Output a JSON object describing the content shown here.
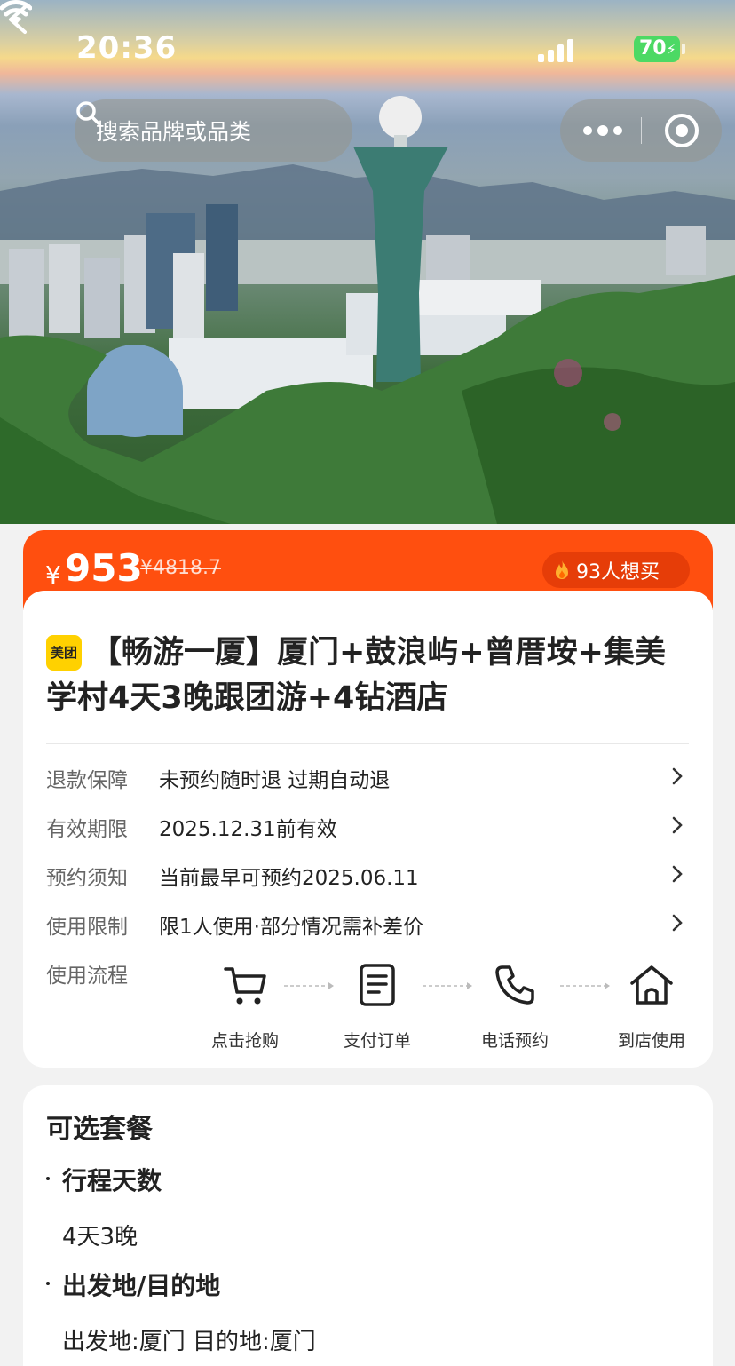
{
  "status_bar": {
    "time": "20:36",
    "battery": "70"
  },
  "nav": {
    "search_placeholder": "搜索品牌或品类"
  },
  "price": {
    "currency": "¥",
    "current": "953",
    "original": "¥4818.7",
    "want_count": "93人想买"
  },
  "product": {
    "brand": "美团",
    "title": "【畅游一厦】厦门+鼓浪屿+曾厝垵+集美学村4天3晚跟团游+4钻酒店"
  },
  "info_rows": [
    {
      "label": "退款保障",
      "value": "未预约随时退 过期自动退"
    },
    {
      "label": "有效期限",
      "value": "2025.12.31前有效"
    },
    {
      "label": "预约须知",
      "value": "当前最早可预约2025.06.11"
    },
    {
      "label": "使用限制",
      "value": "限1人使用·部分情况需补差价"
    }
  ],
  "usage_flow": {
    "label": "使用流程",
    "steps": [
      {
        "label": "点击抢购",
        "icon": "cart-icon"
      },
      {
        "label": "支付订单",
        "icon": "document-icon"
      },
      {
        "label": "电话预约",
        "icon": "phone-icon"
      },
      {
        "label": "到店使用",
        "icon": "home-icon"
      }
    ]
  },
  "packages": {
    "heading": "可选套餐",
    "groups": [
      {
        "title": "行程天数",
        "value": "4天3晚"
      },
      {
        "title": "出发地/目的地",
        "value": "出发地:厦门 目的地:厦门"
      }
    ]
  },
  "colors": {
    "accent": "#ff4f0f",
    "brand_yellow": "#ffd100"
  }
}
